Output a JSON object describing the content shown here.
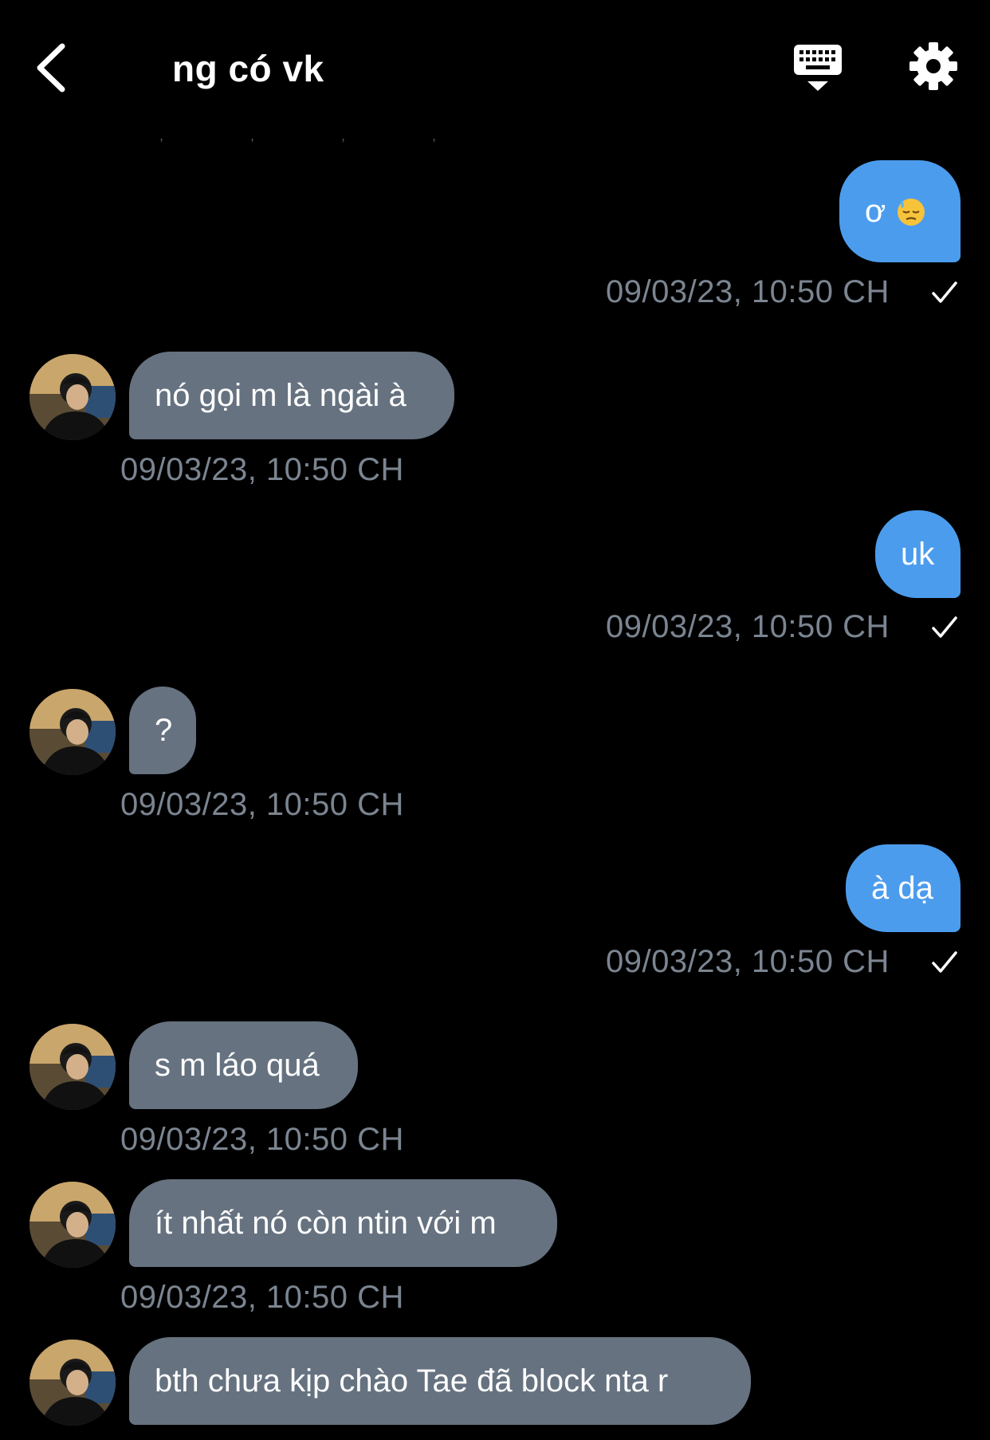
{
  "header": {
    "title": "ng có vk",
    "back_icon": "chevron-left-icon",
    "keyboard_icon": "keyboard-icon",
    "settings_icon": "gear-icon",
    "faint_dots": ", , , ,"
  },
  "colors": {
    "background": "#000000",
    "sent_bubble": "#4c9ced",
    "received_bubble": "#667280",
    "timestamp": "#7b8591"
  },
  "messages": [
    {
      "direction": "sent",
      "text": "ơ",
      "emoji": "downcast-face-with-sweat",
      "time": "09/03/23, 10:50 CH",
      "read_check": true
    },
    {
      "direction": "received",
      "text": "nó gọi m là ngài à",
      "time": "09/03/23, 10:50 CH"
    },
    {
      "direction": "sent",
      "text": "uk",
      "time": "09/03/23, 10:50 CH",
      "read_check": true
    },
    {
      "direction": "received",
      "text": "?",
      "time": "09/03/23, 10:50 CH"
    },
    {
      "direction": "sent",
      "text": "à dạ",
      "time": "09/03/23, 10:50 CH",
      "read_check": true
    },
    {
      "direction": "received",
      "text": "s m láo quá",
      "time": "09/03/23, 10:50 CH"
    },
    {
      "direction": "received",
      "text": "ít nhất nó còn ntin với m",
      "time": "09/03/23, 10:50 CH"
    },
    {
      "direction": "received",
      "text": "bth chưa kịp chào Tae đã block nta r"
    }
  ]
}
